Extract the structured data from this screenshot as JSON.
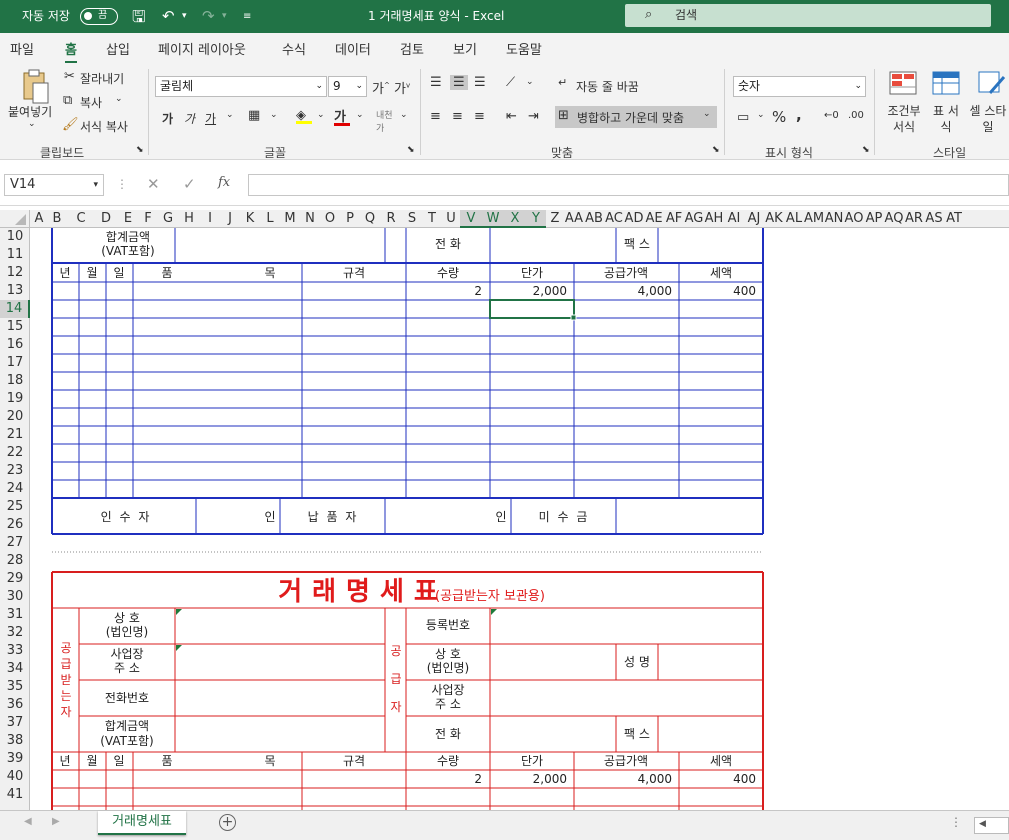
{
  "titlebar": {
    "autosave_label": "자동 저장",
    "autosave_state": "끔",
    "title": "1 거래명세표 양식  -  Excel",
    "search_placeholder": "검색"
  },
  "tabs": [
    "파일",
    "홈",
    "삽입",
    "페이지 레이아웃",
    "수식",
    "데이터",
    "검토",
    "보기",
    "도움말"
  ],
  "active_tab": "홈",
  "ribbon": {
    "clipboard": {
      "paste": "붙여넣기",
      "cut": "잘라내기",
      "copy": "복사",
      "format_painter": "서식 복사",
      "group": "클립보드"
    },
    "font": {
      "name": "굴림체",
      "size": "9",
      "bold": "가",
      "italic": "가",
      "underline": "가",
      "group": "글꼴"
    },
    "alignment": {
      "wrap": "자동 줄 바꿈",
      "merge": "병합하고 가운데 맞춤",
      "group": "맞춤"
    },
    "number": {
      "format": "숫자",
      "group": "표시 형식"
    },
    "styles": {
      "conditional": "조건부 서식",
      "table": "표 서식",
      "cell": "셀 스타일",
      "group": "스타일"
    }
  },
  "formula_bar": {
    "name_box": "V14",
    "formula": ""
  },
  "columns": [
    "A",
    "B",
    "C",
    "D",
    "E",
    "F",
    "G",
    "H",
    "I",
    "J",
    "K",
    "L",
    "M",
    "N",
    "O",
    "P",
    "Q",
    "R",
    "S",
    "T",
    "U",
    "V",
    "W",
    "X",
    "Y",
    "Z",
    "AA",
    "AB",
    "AC",
    "AD",
    "AE",
    "AF",
    "AG",
    "AH",
    "AI",
    "AJ",
    "AK",
    "AL",
    "AM",
    "AN",
    "AO",
    "AP",
    "AQ",
    "AR",
    "AS",
    "AT"
  ],
  "rows": [
    "10",
    "11",
    "12",
    "13",
    "14",
    "15",
    "16",
    "17",
    "18",
    "19",
    "20",
    "21",
    "22",
    "23",
    "24",
    "25",
    "26",
    "27",
    "28",
    "29",
    "30",
    "31",
    "32",
    "33",
    "34",
    "35",
    "36",
    "37",
    "38",
    "39",
    "40",
    "41"
  ],
  "invoice_top": {
    "total_label": "합계금액",
    "total_sub": "(VAT포함)",
    "phone_label": "전 화",
    "fax_label": "팩 스",
    "headers": [
      "년",
      "월",
      "일",
      "품",
      "목",
      "규격",
      "수량",
      "단가",
      "공급가액",
      "세액"
    ],
    "item": {
      "qty": "2",
      "price": "2,000",
      "supply": "4,000",
      "tax": "400"
    },
    "receiver_label": "인 수 자",
    "seal": "인",
    "deliverer_label": "납 품 자",
    "unpaid_label": "미 수 금"
  },
  "invoice_bottom": {
    "title": "거래명세표",
    "subtitle": "(공급받는자 보관용)",
    "receiver_side": "공급받는자",
    "supplier_side": "공급자",
    "company_label": "상 호",
    "company_sub": "(법인명)",
    "address_label": "사업장",
    "address_sub": "주 소",
    "phone_label": "전화번호",
    "total_label": "합계금액",
    "total_sub": "(VAT포함)",
    "reg_no_label": "등록번호",
    "name_label": "성 명",
    "tel_label": "전 화",
    "fax_label": "팩 스",
    "headers": [
      "년",
      "월",
      "일",
      "품",
      "목",
      "규격",
      "수량",
      "단가",
      "공급가액",
      "세액"
    ],
    "item": {
      "qty": "2",
      "price": "2,000",
      "supply": "4,000",
      "tax": "400"
    }
  },
  "sheet_tab": "거래명세표",
  "colors": {
    "excel_green": "#217346",
    "blue_border": "#1f2fbf",
    "red_border": "#d81e1e",
    "title_red": "#e01b1b"
  }
}
